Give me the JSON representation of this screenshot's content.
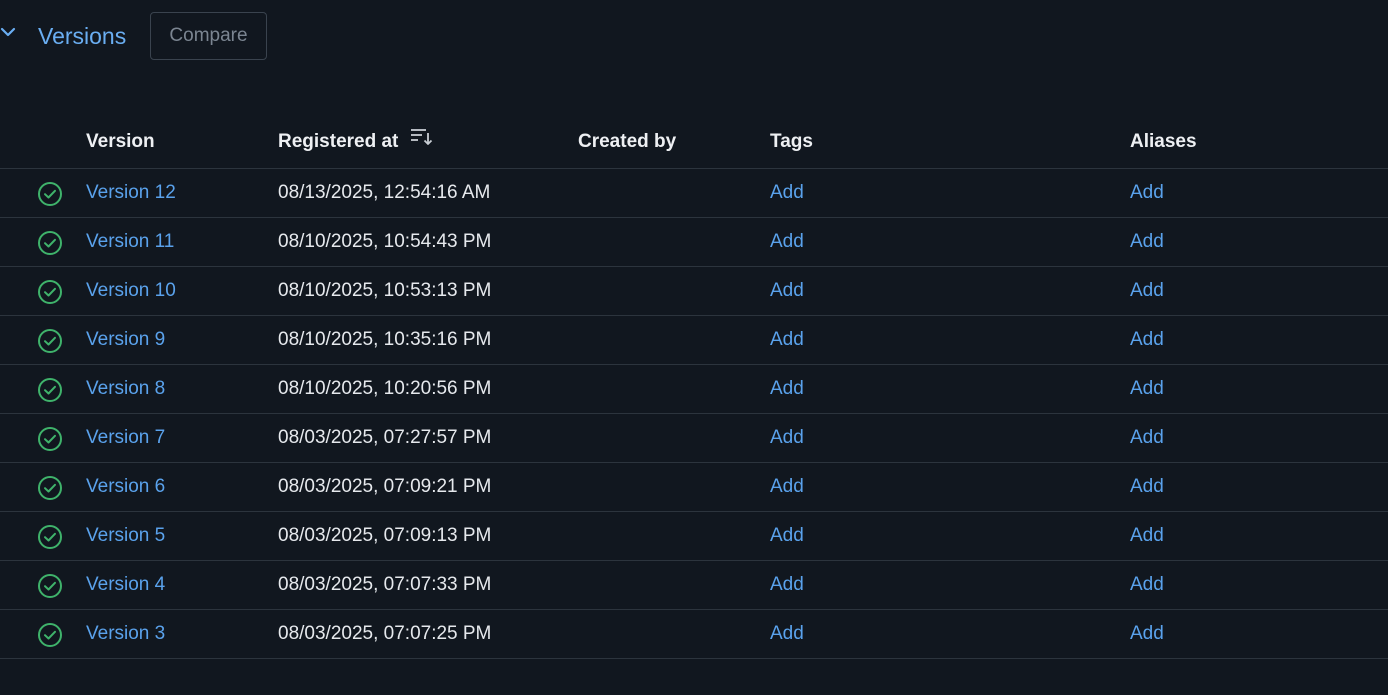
{
  "section": {
    "title": "Versions",
    "compare_label": "Compare",
    "toggle_icon": "chevron-down-icon"
  },
  "table": {
    "columns": {
      "version": "Version",
      "registered_at": "Registered at",
      "created_by": "Created by",
      "tags": "Tags",
      "aliases": "Aliases"
    },
    "sort_icon": "sort-descending-icon",
    "status_icon": "check-circle-icon",
    "rows": [
      {
        "version": "Version 12",
        "registered_at": "08/13/2025, 12:54:16 AM",
        "created_by": "",
        "tags": "Add",
        "aliases": "Add"
      },
      {
        "version": "Version 11",
        "registered_at": "08/10/2025, 10:54:43 PM",
        "created_by": "",
        "tags": "Add",
        "aliases": "Add"
      },
      {
        "version": "Version 10",
        "registered_at": "08/10/2025, 10:53:13 PM",
        "created_by": "",
        "tags": "Add",
        "aliases": "Add"
      },
      {
        "version": "Version 9",
        "registered_at": "08/10/2025, 10:35:16 PM",
        "created_by": "",
        "tags": "Add",
        "aliases": "Add"
      },
      {
        "version": "Version 8",
        "registered_at": "08/10/2025, 10:20:56 PM",
        "created_by": "",
        "tags": "Add",
        "aliases": "Add"
      },
      {
        "version": "Version 7",
        "registered_at": "08/03/2025, 07:27:57 PM",
        "created_by": "",
        "tags": "Add",
        "aliases": "Add"
      },
      {
        "version": "Version 6",
        "registered_at": "08/03/2025, 07:09:21 PM",
        "created_by": "",
        "tags": "Add",
        "aliases": "Add"
      },
      {
        "version": "Version 5",
        "registered_at": "08/03/2025, 07:09:13 PM",
        "created_by": "",
        "tags": "Add",
        "aliases": "Add"
      },
      {
        "version": "Version 4",
        "registered_at": "08/03/2025, 07:07:33 PM",
        "created_by": "",
        "tags": "Add",
        "aliases": "Add"
      },
      {
        "version": "Version 3",
        "registered_at": "08/03/2025, 07:07:25 PM",
        "created_by": "",
        "tags": "Add",
        "aliases": "Add"
      }
    ]
  },
  "colors": {
    "background": "#11171f",
    "link": "#5aa2ec",
    "status_ok": "#3fb36b",
    "border": "#2c343d"
  }
}
